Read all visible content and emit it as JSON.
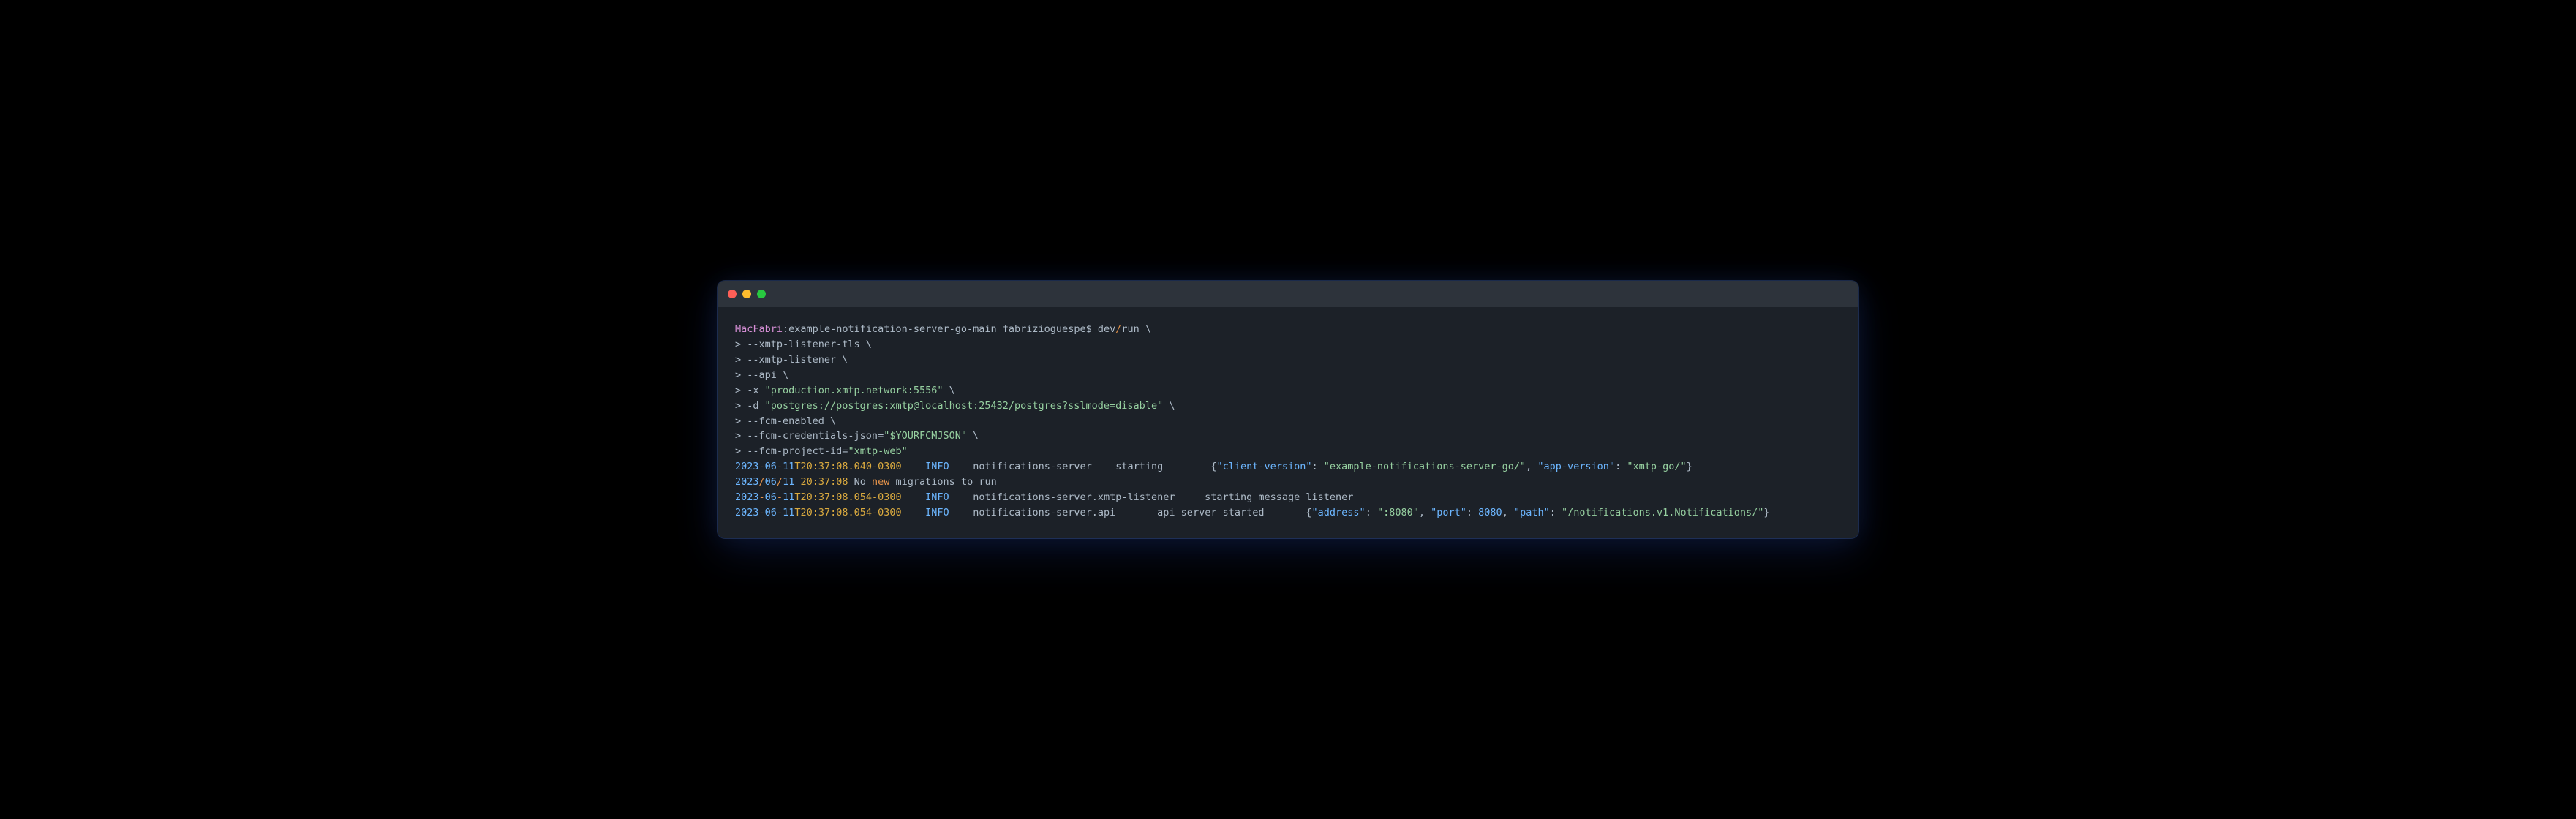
{
  "prompt": {
    "host": "MacFabri",
    "sep1": ":",
    "dir": "example-notification-server-go-main",
    "user": " fabrizioguespe$ ",
    "cmd_prefix": "dev",
    "cmd_slash": "/",
    "cmd_name": "run",
    "cont": " \\"
  },
  "lines": {
    "l1": {
      "prefix": "> --xmtp-listener-tls \\"
    },
    "l2": {
      "prefix": "> --xmtp-listener \\"
    },
    "l3": {
      "prefix": "> --api \\"
    },
    "l4": {
      "prefix": "> -x ",
      "str": "\"production.xmtp.network:5556\"",
      "suffix": " \\"
    },
    "l5": {
      "prefix": "> -d ",
      "str": "\"postgres://postgres:xmtp@localhost:25432/postgres?sslmode=disable\"",
      "suffix": " \\"
    },
    "l6": {
      "prefix": "> --fcm-enabled \\"
    },
    "l7": {
      "prefix": "> --fcm-credentials-json=",
      "str": "\"$YOURFCMJSON\"",
      "suffix": " \\"
    },
    "l8": {
      "prefix": "> --fcm-project-id=",
      "str": "\"xmtp-web\""
    }
  },
  "log1": {
    "d1": "2023",
    "s1": "-",
    "d2": "06",
    "s2": "-",
    "d3": "11",
    "t": "T20:37:08.040-0300",
    "gap1": "    ",
    "level": "INFO",
    "gap2": "    ",
    "comp": "notifications-server",
    "gap3": "    ",
    "msg": "starting",
    "gap4": "        ",
    "jo": "{",
    "k1": "\"client-version\"",
    "c1": ": ",
    "v1": "\"example-notifications-server-go/\"",
    "cm1": ", ",
    "k2": "\"app-version\"",
    "c2": ": ",
    "v2": "\"xmtp-go/\"",
    "jc": "}"
  },
  "log2": {
    "d1": "2023",
    "s1": "/",
    "d2": "06",
    "s2": "/",
    "d3": "11",
    "sp": " ",
    "time": "20:37:08",
    "txt1": " No ",
    "kw": "new",
    "txt2": " migrations to run"
  },
  "log3": {
    "d1": "2023",
    "s1": "-",
    "d2": "06",
    "s2": "-",
    "d3": "11",
    "t": "T20:37:08.054-0300",
    "gap1": "    ",
    "level": "INFO",
    "gap2": "    ",
    "comp": "notifications-server.xmtp-listener",
    "gap3": "     ",
    "msg": "starting message listener"
  },
  "log4": {
    "d1": "2023",
    "s1": "-",
    "d2": "06",
    "s2": "-",
    "d3": "11",
    "t": "T20:37:08.054-0300",
    "gap1": "    ",
    "level": "INFO",
    "gap2": "    ",
    "comp": "notifications-server.api",
    "gap3": "       ",
    "msg": "api server started",
    "gap4": "       ",
    "jo": "{",
    "k1": "\"address\"",
    "c1": ": ",
    "v1": "\":8080\"",
    "cm1": ", ",
    "k2": "\"port\"",
    "c2": ": ",
    "n2": "8080",
    "cm2": ", ",
    "k3": "\"path\"",
    "c3": ": ",
    "v3": "\"/notifications.v1.Notifications/\"",
    "jc": "}"
  }
}
